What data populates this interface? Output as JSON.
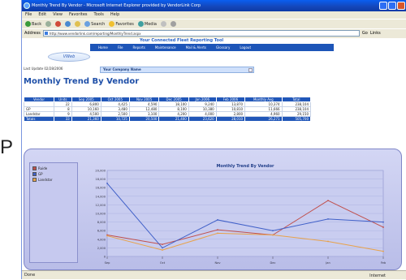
{
  "window": {
    "title": "Monthly Trend By Vendor - Microsoft Internet Explorer provided by VendorLink Corp"
  },
  "menu": [
    "File",
    "Edit",
    "View",
    "Favorites",
    "Tools",
    "Help"
  ],
  "toolbar": {
    "back": "Back",
    "search": "Search",
    "favorites": "Favorites",
    "media": "Media"
  },
  "address": {
    "label": "Address",
    "url": "http://www.vendorlink.com/reporting/MonthlyTrend.aspx",
    "go": "Go",
    "links": "Links"
  },
  "banner": {
    "title": "Your Connected Fleet Reporting Tool",
    "nav": [
      "Home",
      "File",
      "Reports",
      "Maintenance",
      "Mail & Alerts",
      "Glossary",
      "Logout"
    ],
    "logo": "VWeb"
  },
  "page": {
    "last_update": "Last Update 02/28/2006",
    "company": "Your Company Name",
    "title": "Monthly Trend By Vendor"
  },
  "table": {
    "headers": [
      "Vendor",
      "Units",
      "Sep 2005",
      "Oct 2005",
      "Nov 2005",
      "Dec 2005",
      "Jan 2006",
      "Feb 2006",
      "Monthly Avg",
      "Total"
    ],
    "rows": [
      [
        "",
        "22",
        "6,800",
        "4,425",
        "4,590",
        "18,100",
        "9,240",
        "13,870",
        "10,374",
        "238,104"
      ],
      [
        "GP",
        "8",
        "10,160",
        "3,480",
        "12,480",
        "8,100",
        "10,380",
        "10,810",
        "11,666",
        "238,104"
      ],
      [
        "Landstar",
        "9",
        "4,500",
        "2,500",
        "3,100",
        "4,200",
        "4,000",
        "2,800",
        "4,960",
        "29,150"
      ]
    ],
    "total": [
      "Totals",
      "33",
      "21,360",
      "10,725",
      "20,500",
      "21,400",
      "23,620",
      "28,010",
      "26,271",
      "505,700"
    ]
  },
  "chart_data": {
    "type": "line",
    "title": "Monthly Trend By Vendor",
    "categories": [
      "Sep",
      "Oct",
      "Nov",
      "Dec",
      "Jan",
      "Feb"
    ],
    "ylim": [
      0,
      20000
    ],
    "yticks": [
      "20,000",
      "18,000",
      "16,000",
      "14,000",
      "12,000",
      "10,000",
      "8,000",
      "6,000",
      "4,000",
      "2,000",
      "0"
    ],
    "series": [
      {
        "name": "Ruide",
        "color": "#c0504d",
        "values": [
          5000,
          2800,
          6200,
          5000,
          13000,
          6800
        ]
      },
      {
        "name": "GP",
        "color": "#4060c8",
        "values": [
          17000,
          2000,
          8500,
          6000,
          8700,
          8000
        ]
      },
      {
        "name": "Landstar",
        "color": "#e8a24a",
        "values": [
          4800,
          1500,
          5400,
          5000,
          3500,
          1200
        ]
      }
    ],
    "grid": true,
    "legend_position": "left"
  },
  "status": {
    "text": "Done",
    "zone": "Internet"
  },
  "side_text": "P"
}
